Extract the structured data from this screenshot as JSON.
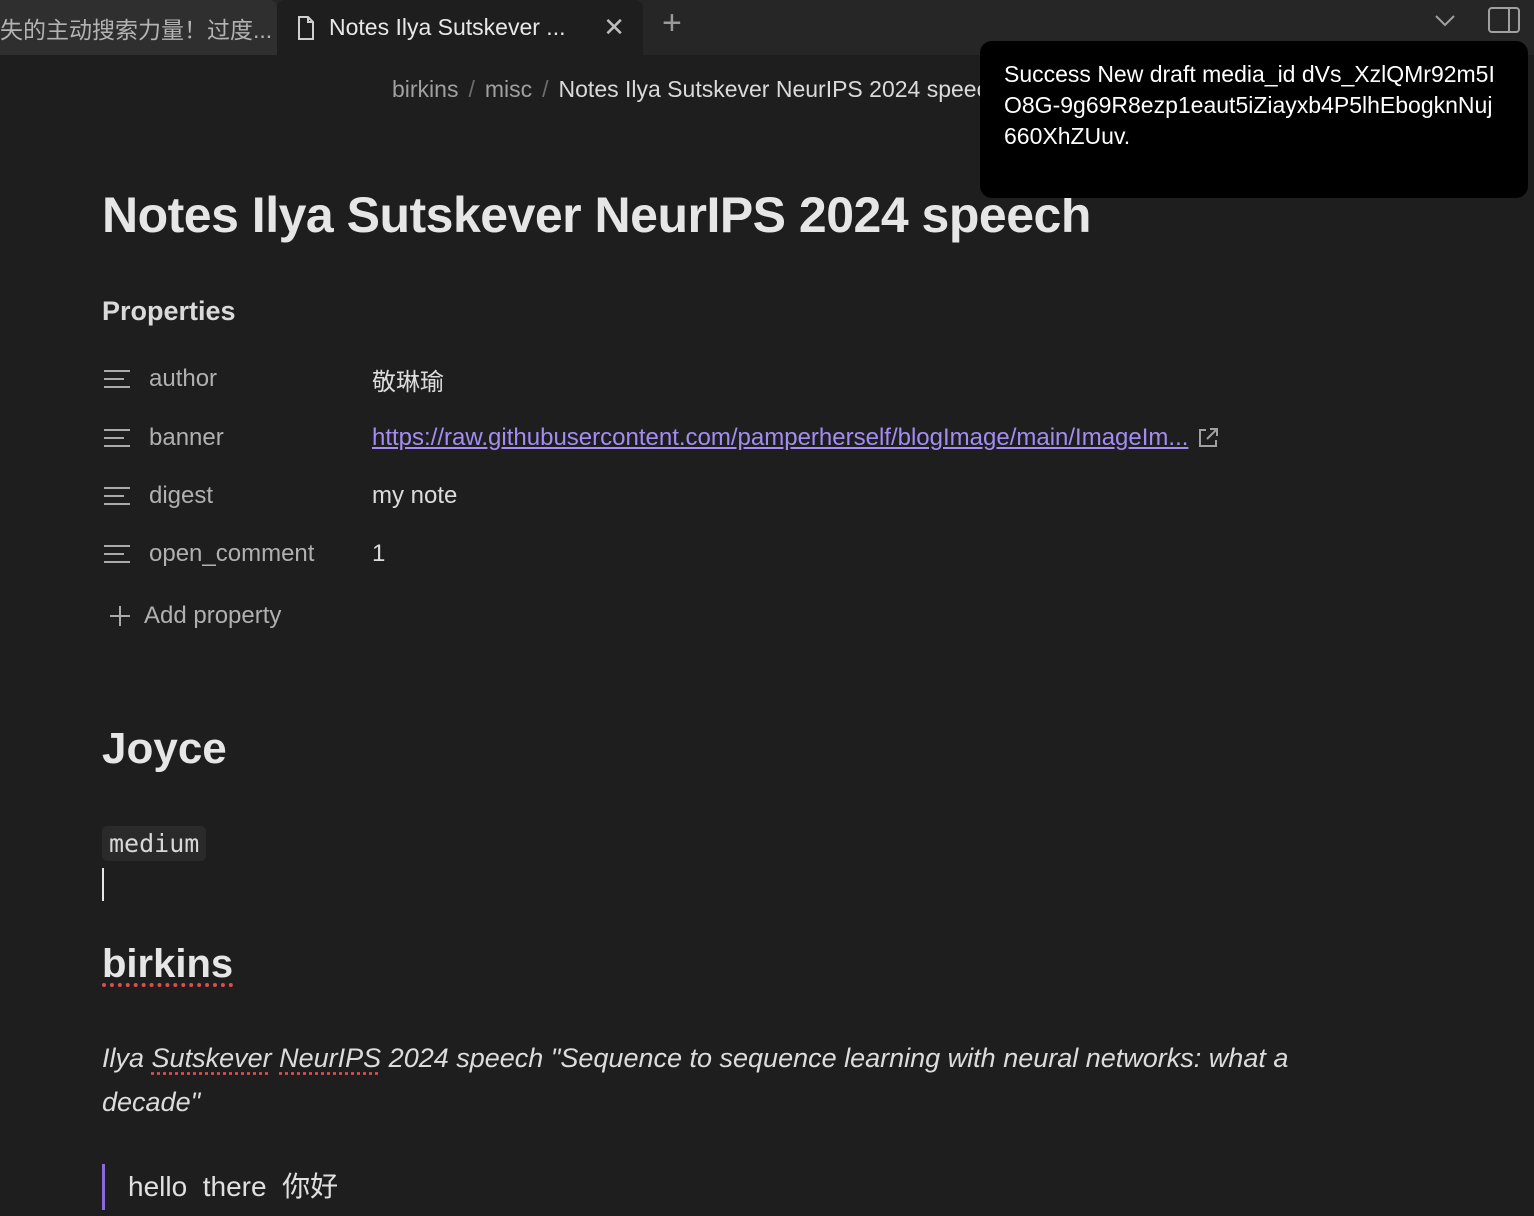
{
  "tabs": {
    "inactive_label": "失的主动搜索力量！过度...",
    "active_label": "Notes Ilya Sutskever ...",
    "close_symbol": "✕",
    "new_tab_symbol": "+"
  },
  "breadcrumb": {
    "items": [
      "birkins",
      "misc",
      "Notes Ilya Sutskever NeurIPS 2024 speech"
    ],
    "separator": "/"
  },
  "notice": {
    "text": "Success New draft media_id dVs_XzlQMr92m5IO8G-9g69R8ezp1eaut5iZiayxb4P5lhEbogknNuj660XhZUuv."
  },
  "note": {
    "title": "Notes Ilya Sutskever NeurIPS 2024 speech",
    "properties_heading": "Properties",
    "properties": [
      {
        "key": "author",
        "value": "敬琳瑜"
      },
      {
        "key": "banner",
        "value": "https://raw.githubusercontent.com/pamperherself/blogImage/main/ImageIm..."
      },
      {
        "key": "digest",
        "value": "my note"
      },
      {
        "key": "open_comment",
        "value": "1"
      }
    ],
    "add_property": "Add property",
    "heading_joyce": "Joyce",
    "code_tag": "medium",
    "heading_birkins": "birkins",
    "italic_para": {
      "word1": "Ilya",
      "word2": "Sutskever",
      "word3": "NeurIPS",
      "rest": " 2024 speech  \"Sequence to sequence learning with neural networks: what a decade\""
    },
    "quote": "hello  there  你好"
  },
  "colors": {
    "background": "#1e1e1e",
    "accent": "#a48cf2",
    "quote_border": "#8a6ad8",
    "spellcheck": "#e04a4a"
  }
}
